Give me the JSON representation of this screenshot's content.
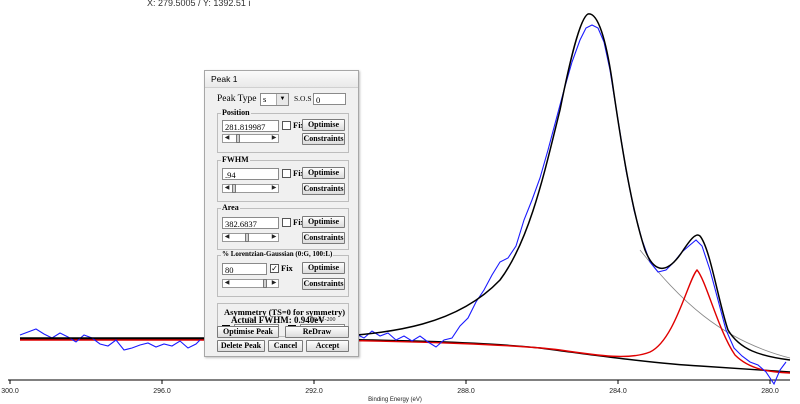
{
  "cursor_readout": "X: 279.5005 / Y: 1392.51 i",
  "axis": {
    "xlabel": "Binding Energy (eV)",
    "ticks": [
      "300.0",
      "296.0",
      "292.0",
      "288.0",
      "284.0",
      "280.0"
    ]
  },
  "dialog": {
    "title": "Peak 1",
    "peak_type_label": "Peak Type",
    "peak_type_value": "s",
    "sos_label": "S.O.S",
    "sos_value": "0",
    "position": {
      "label": "Position",
      "value": "281.819987",
      "fix_label": "Fix",
      "fixed": false,
      "optimise": "Optimise",
      "constraints": "Constraints",
      "slider_fraction": 0.3
    },
    "fwhm": {
      "label": "FWHM",
      "value": ".94",
      "fix_label": "Fix",
      "fixed": false,
      "optimise": "Optimise",
      "constraints": "Constraints",
      "slider_fraction": 0.2
    },
    "area": {
      "label": "Area",
      "value": "382.6837",
      "fix_label": "Fix",
      "fixed": false,
      "optimise": "Optimise",
      "constraints": "Constraints",
      "slider_fraction": 0.45
    },
    "lg": {
      "label": "% Lorentzian-Gaussian (0:G, 100:L)",
      "value": "80",
      "fix_label": "Fix",
      "fixed": true,
      "optimise": "Optimise",
      "constraints": "Constraints",
      "slider_fraction": 0.8
    },
    "asymmetry": {
      "label": "Asymmetry (TS=0 for symmetry)",
      "range1": "0-1",
      "range2": "0.01-200",
      "value1": "0",
      "value2": "1"
    },
    "actual_fwhm": "Actual FWHM:  0.940eV",
    "buttons": {
      "optimise_peak": "Optimise Peak",
      "redraw": "ReDraw",
      "delete_peak": "Delete Peak",
      "cancel": "Cancel",
      "accept": "Accept"
    }
  }
}
